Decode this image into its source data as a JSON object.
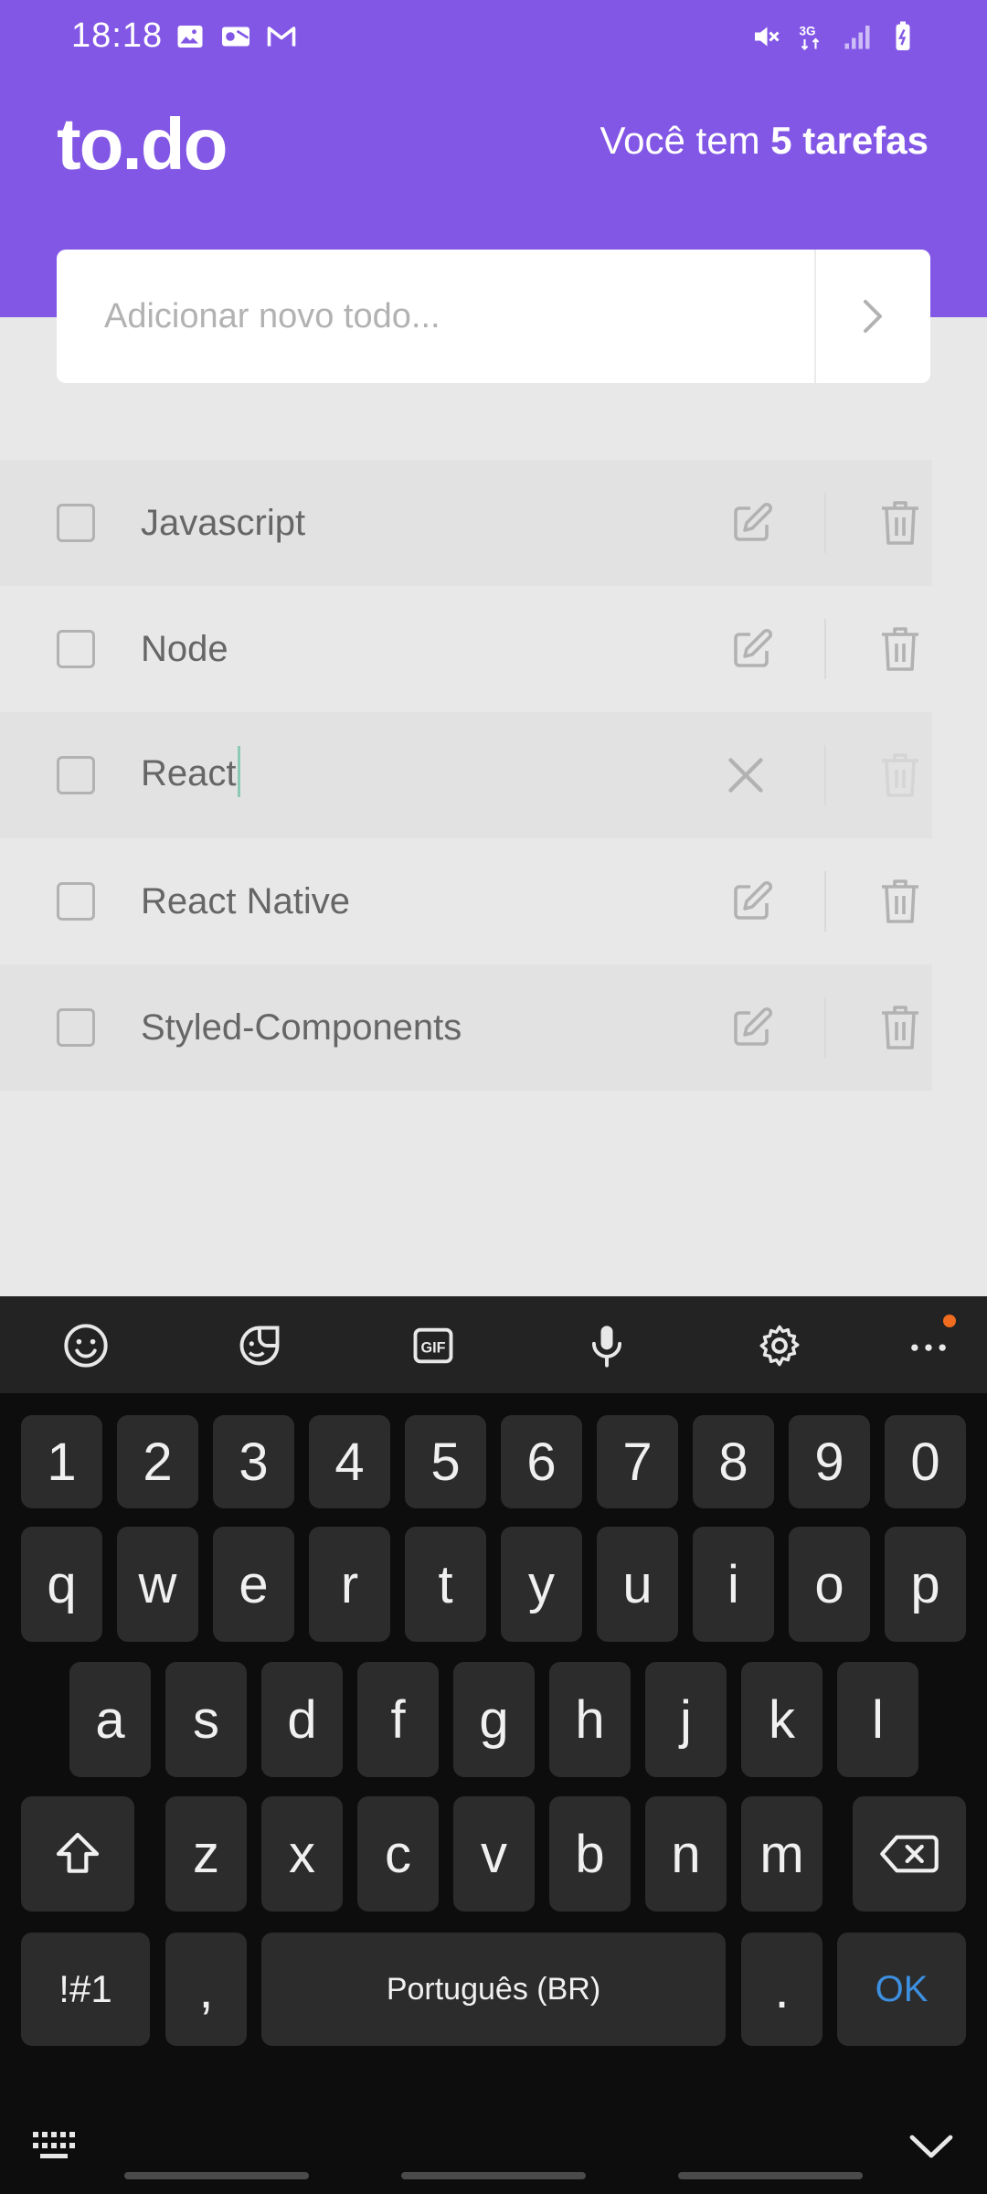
{
  "status_bar": {
    "time": "18:18",
    "network": "3G"
  },
  "header": {
    "logo": "to.do",
    "counter_prefix": "Você tem ",
    "counter_bold": "5 tarefas"
  },
  "add_todo": {
    "placeholder": "Adicionar novo todo..."
  },
  "tasks": [
    {
      "title": "Javascript",
      "done": false,
      "editing": false
    },
    {
      "title": "Node",
      "done": false,
      "editing": false
    },
    {
      "title": "React",
      "done": false,
      "editing": true
    },
    {
      "title": "React Native",
      "done": false,
      "editing": false
    },
    {
      "title": "Styled-Components",
      "done": false,
      "editing": false
    }
  ],
  "keyboard": {
    "toolbar_icons": [
      "emoji-icon",
      "sticker-icon",
      "gif-icon",
      "microphone-icon",
      "settings-icon",
      "more-icon"
    ],
    "gif_label": "GIF",
    "row_numbers": [
      "1",
      "2",
      "3",
      "4",
      "5",
      "6",
      "7",
      "8",
      "9",
      "0"
    ],
    "row_1": [
      "q",
      "w",
      "e",
      "r",
      "t",
      "y",
      "u",
      "i",
      "o",
      "p"
    ],
    "row_2": [
      "a",
      "s",
      "d",
      "f",
      "g",
      "h",
      "j",
      "k",
      "l"
    ],
    "row_3": [
      "z",
      "x",
      "c",
      "v",
      "b",
      "n",
      "m"
    ],
    "symbols_label": "!#1",
    "comma": ",",
    "space_label": "Português (BR)",
    "period": ".",
    "ok_label": "OK"
  },
  "colors": {
    "brand": "#8257e5",
    "background": "#e8e8e8",
    "caret": "#8ec9b8",
    "ok_key": "#3d8fe0",
    "badge": "#f06c1e"
  }
}
